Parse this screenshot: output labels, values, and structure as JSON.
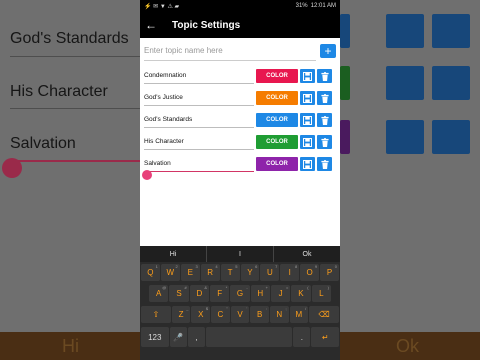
{
  "statusbar": {
    "icons": "⚡  ✉  ▼  ⚠ ▰",
    "battery": "31%",
    "time": "12:01 AM"
  },
  "appbar": {
    "back_icon": "←",
    "title": "Topic Settings"
  },
  "add_topic": {
    "placeholder": "Enter topic name here",
    "add_label": "+"
  },
  "topics": [
    {
      "name": "Condemnation",
      "color_label": "COLOR",
      "color": "#e8174f"
    },
    {
      "name": "God's Justice",
      "color_label": "COLOR",
      "color": "#f57c00"
    },
    {
      "name": "God's Standards",
      "color_label": "COLOR",
      "color": "#1e88e5"
    },
    {
      "name": "His Character",
      "color_label": "COLOR",
      "color": "#1f9d33"
    },
    {
      "name": "Salvation",
      "color_label": "COLOR",
      "color": "#8e24aa"
    }
  ],
  "background": {
    "left_topics": [
      "God's Standards",
      "His Character",
      "Salvation"
    ],
    "keyboard_left": "Hi",
    "keyboard_right": "Ok"
  },
  "keyboard": {
    "suggestions": [
      "Hi",
      "I",
      "Ok"
    ],
    "row1": [
      [
        "Q",
        "1"
      ],
      [
        "W",
        "2"
      ],
      [
        "E",
        "3"
      ],
      [
        "R",
        "4"
      ],
      [
        "T",
        "5"
      ],
      [
        "Y",
        "6"
      ],
      [
        "U",
        "7"
      ],
      [
        "I",
        "8"
      ],
      [
        "O",
        "9"
      ],
      [
        "P",
        "0"
      ]
    ],
    "row2": [
      [
        "A",
        "@"
      ],
      [
        "S",
        "#"
      ],
      [
        "D",
        "&"
      ],
      [
        "F",
        "*"
      ],
      [
        "G",
        "-"
      ],
      [
        "H",
        "+"
      ],
      [
        "J",
        "="
      ],
      [
        "K",
        "("
      ],
      [
        "L",
        ")"
      ]
    ],
    "row3": [
      [
        "Z",
        "_"
      ],
      [
        "X",
        "$"
      ],
      [
        "C",
        "\""
      ],
      [
        "V",
        "'"
      ],
      [
        "B",
        ":"
      ],
      [
        "N",
        ";"
      ],
      [
        "M",
        "/"
      ]
    ],
    "shift_icon": "⇧",
    "backspace_icon": "⌫",
    "numbers_label": "123",
    "mic_icon": "🎤",
    "comma": ",",
    "period": ".",
    "enter_icon": "↵"
  }
}
